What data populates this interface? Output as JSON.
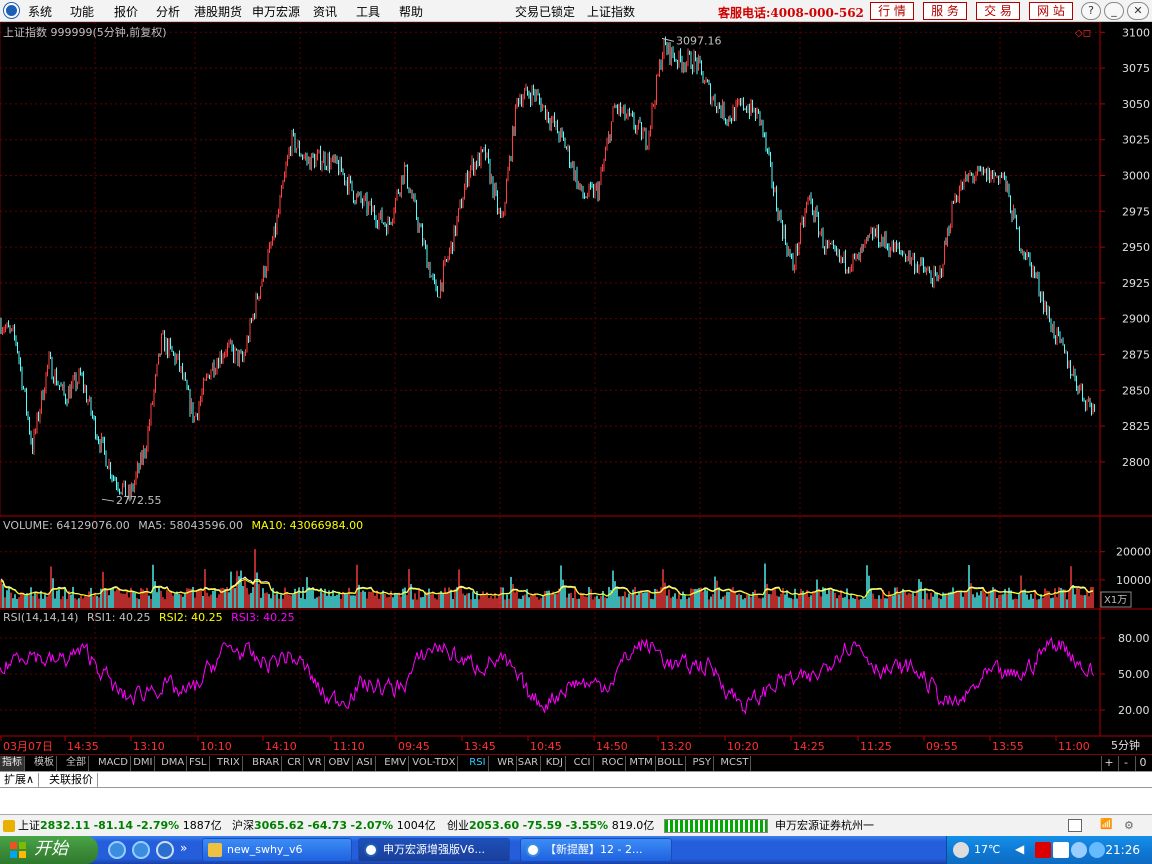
{
  "menu": {
    "items": [
      "系统",
      "功能",
      "报价",
      "分析",
      "港股期货",
      "申万宏源",
      "资讯",
      "工具",
      "帮助"
    ],
    "lock_status": "交易已锁定",
    "current_index": "上证指数",
    "hotline": "客服电话:4008-000-562",
    "buttons": [
      "行 情",
      "服 务",
      "交 易",
      "网 站"
    ],
    "window_controls": [
      "?",
      "_",
      "◫",
      "✕"
    ]
  },
  "price_panel": {
    "title": "上证指数 999999(5分钟,前复权)",
    "y_ticks": [
      "3100",
      "3075",
      "3050",
      "3025",
      "3000",
      "2975",
      "2950",
      "2925",
      "2900",
      "2875",
      "2850",
      "2825",
      "2800"
    ],
    "high_label": "3097.16",
    "low_label": "2772.55",
    "y_range": [
      2765,
      3103
    ],
    "up_color": "#ff4040",
    "down_color": "#54fcfc"
  },
  "volume_panel": {
    "label_prefix": "VOLUME: 64129076.00",
    "ma5": "MA5: 58043596.00",
    "ma10": "MA10: 43066984.00",
    "y_ticks": [
      "20000",
      "10000"
    ],
    "unit": "X1万",
    "y_range": [
      0,
      27000
    ]
  },
  "rsi_panel": {
    "label_prefix": "RSI(14,14,14)",
    "rsi1": "RSI1: 40.25",
    "rsi2": "RSI2: 40.25",
    "rsi3": "RSI3: 40.25",
    "y_ticks": [
      "80.00",
      "50.00",
      "20.00"
    ],
    "y_range": [
      0,
      100
    ],
    "line_color": "#ff00ff"
  },
  "time_axis": {
    "labels": [
      "03月07日",
      "14:35",
      "13:10",
      "10:10",
      "14:10",
      "11:10",
      "09:45",
      "13:45",
      "10:45",
      "14:50",
      "13:20",
      "10:20",
      "14:25",
      "11:25",
      "09:55",
      "13:55",
      "11:00"
    ],
    "period": "5分钟"
  },
  "chart_data": {
    "type": "candlestick",
    "title": "上证指数 999999(5分钟,前复权)",
    "close_path_points": [
      [
        0,
        2898
      ],
      [
        1,
        2885
      ],
      [
        2,
        2810
      ],
      [
        3,
        2870
      ],
      [
        4,
        2845
      ],
      [
        5,
        2860
      ],
      [
        6,
        2820
      ],
      [
        7,
        2790
      ],
      [
        8,
        2775
      ],
      [
        9,
        2810
      ],
      [
        10,
        2885
      ],
      [
        11,
        2870
      ],
      [
        12,
        2830
      ],
      [
        13,
        2865
      ],
      [
        14,
        2880
      ],
      [
        15,
        2870
      ],
      [
        16,
        2920
      ],
      [
        17,
        2960
      ],
      [
        18,
        3025
      ],
      [
        19,
        3010
      ],
      [
        20,
        3012
      ],
      [
        21,
        3005
      ],
      [
        22,
        2985
      ],
      [
        23,
        2975
      ],
      [
        24,
        2965
      ],
      [
        25,
        3005
      ],
      [
        26,
        2960
      ],
      [
        27,
        2915
      ],
      [
        28,
        2955
      ],
      [
        29,
        3005
      ],
      [
        30,
        3015
      ],
      [
        31,
        2965
      ],
      [
        32,
        3055
      ],
      [
        33,
        3058
      ],
      [
        34,
        3040
      ],
      [
        35,
        3020
      ],
      [
        36,
        2985
      ],
      [
        37,
        2990
      ],
      [
        38,
        3048
      ],
      [
        39,
        3038
      ],
      [
        40,
        3025
      ],
      [
        41,
        3090
      ],
      [
        42,
        3080
      ],
      [
        43,
        3080
      ],
      [
        44,
        3055
      ],
      [
        45,
        3040
      ],
      [
        46,
        3050
      ],
      [
        47,
        3040
      ],
      [
        48,
        2980
      ],
      [
        49,
        2935
      ],
      [
        50,
        2985
      ],
      [
        51,
        2950
      ],
      [
        52,
        2940
      ],
      [
        53,
        2940
      ],
      [
        54,
        2960
      ],
      [
        55,
        2950
      ],
      [
        56,
        2945
      ],
      [
        57,
        2935
      ],
      [
        58,
        2925
      ],
      [
        59,
        2985
      ],
      [
        60,
        3000
      ],
      [
        61,
        3000
      ],
      [
        62,
        3000
      ],
      [
        63,
        2955
      ],
      [
        64,
        2930
      ],
      [
        65,
        2895
      ],
      [
        66,
        2870
      ],
      [
        67,
        2845
      ],
      [
        68,
        2832
      ]
    ],
    "high_marker": 3097.16,
    "low_marker": 2772.55,
    "volume_ticks": [
      20000,
      10000
    ],
    "rsi_ticks": [
      80,
      50,
      20
    ]
  },
  "indicator_tabs": [
    "指标",
    "模板",
    "全部",
    "MACD",
    "DMI",
    "DMA",
    "FSL",
    "TRIX",
    "BRAR",
    "CR",
    "VR",
    "OBV",
    "ASI",
    "EMV",
    "VOL-TDX",
    "RSI",
    "WR",
    "SAR",
    "KDJ",
    "CCI",
    "ROC",
    "MTM",
    "BOLL",
    "PSY",
    "MCST"
  ],
  "active_indicator": "RSI",
  "tab_controls": [
    "+",
    "-",
    "0"
  ],
  "sub_tabs": [
    "扩展∧",
    "关联报价"
  ],
  "status": {
    "sh_name": "上证",
    "sh_value": "2832.11",
    "sh_change": "-81.14",
    "sh_pct": "-2.79%",
    "sh_amount": "1887亿",
    "hs_name": "沪深",
    "hs_value": "3065.62",
    "hs_change": "-64.73",
    "hs_pct": "-2.07%",
    "hs_amount": "1004亿",
    "cy_name": "创业",
    "cy_value": "2053.60",
    "cy_change": "-75.59",
    "cy_pct": "-3.55%",
    "cy_amount": "819.0亿",
    "broker": "申万宏源证券杭州一"
  },
  "taskbar": {
    "start_label": "开始",
    "tasks": [
      "new_swhy_v6",
      "申万宏源增强版V6...",
      "【新提醒】12 - 2..."
    ],
    "temperature": "17℃",
    "clock": "21:26"
  }
}
